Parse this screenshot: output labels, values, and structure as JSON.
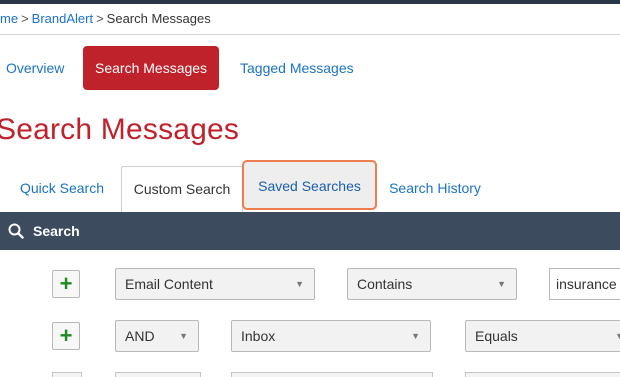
{
  "breadcrumb": {
    "items": [
      "me",
      "BrandAlert"
    ],
    "current": "Search Messages",
    "separator": ">"
  },
  "subnav": {
    "items": [
      {
        "label": "Overview"
      },
      {
        "label": "Search Messages",
        "active": true
      },
      {
        "label": "Tagged Messages"
      }
    ]
  },
  "page": {
    "title": "Search Messages"
  },
  "tabs": [
    {
      "label": "Quick Search"
    },
    {
      "label": "Custom Search",
      "active": true
    },
    {
      "label": "Saved Searches",
      "highlighted": true
    },
    {
      "label": "Search History"
    }
  ],
  "search_bar": {
    "label": "Search",
    "icon": "search-icon"
  },
  "criteria": {
    "add_symbol": "+",
    "row1": {
      "field": "Email Content",
      "operator": "Contains",
      "value": "insurance"
    },
    "row2": {
      "connector": "AND",
      "field": "Inbox",
      "operator": "Equals"
    }
  },
  "colors": {
    "brand_red": "#c0222b",
    "link_blue": "#1a73c7",
    "header_dark": "#3c4b5e",
    "highlight_orange": "#f07d4f",
    "add_green": "#1f8a1f"
  }
}
